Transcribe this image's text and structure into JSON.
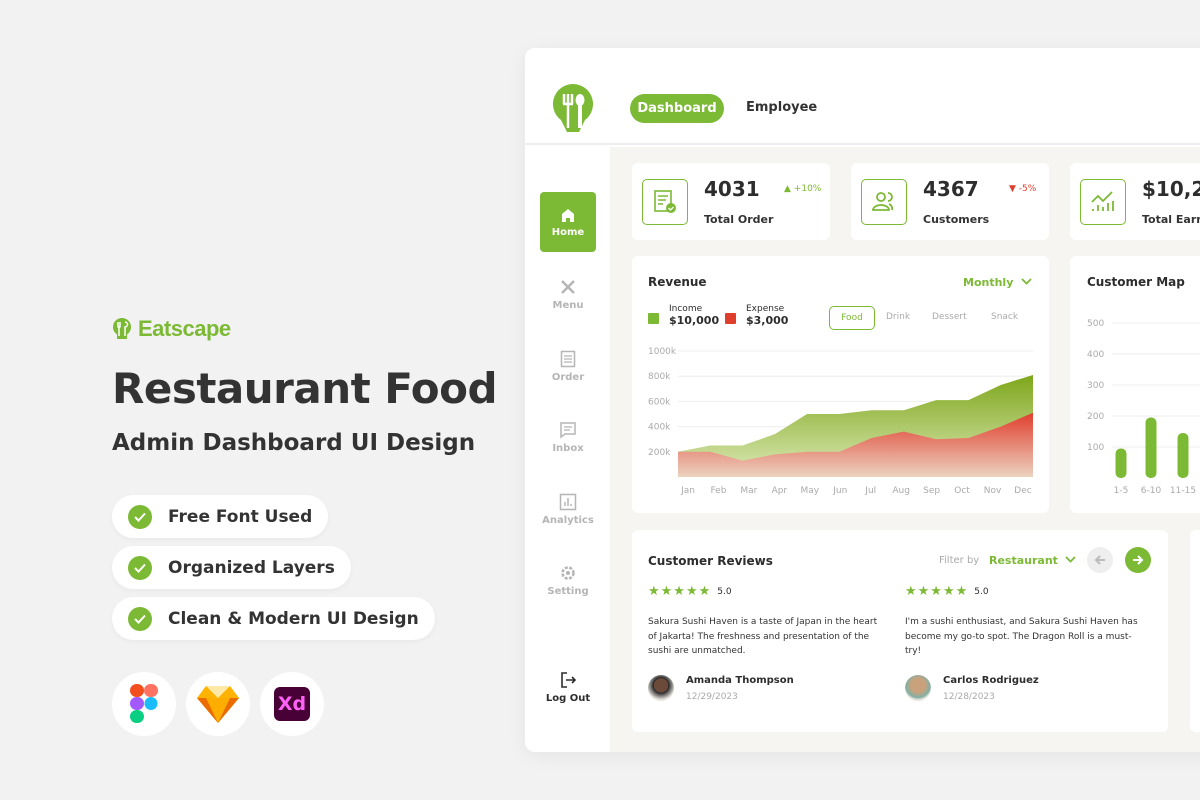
{
  "promo": {
    "brand": "Eatscape",
    "title": "Restaurant Food",
    "subtitle": "Admin Dashboard UI Design",
    "features": [
      "Free Font Used",
      "Organized Layers",
      "Clean & Modern UI Design"
    ],
    "tools": [
      {
        "name": "figma-icon"
      },
      {
        "name": "sketch-icon"
      },
      {
        "name": "xd-icon",
        "label": "Xd"
      }
    ]
  },
  "header": {
    "tabs": [
      {
        "label": "Dashboard",
        "active": true
      },
      {
        "label": "Employee",
        "active": false
      }
    ]
  },
  "sidebar": {
    "items": [
      {
        "label": "Home",
        "icon": "home-icon",
        "active": true
      },
      {
        "label": "Menu",
        "icon": "utensils-icon"
      },
      {
        "label": "Order",
        "icon": "receipt-icon"
      },
      {
        "label": "Inbox",
        "icon": "message-icon"
      },
      {
        "label": "Analytics",
        "icon": "chart-icon"
      },
      {
        "label": "Setting",
        "icon": "gear-icon"
      }
    ],
    "logout": "Log Out"
  },
  "stats": [
    {
      "value": "4031",
      "label": "Total Order",
      "change": "+10%",
      "trend": "up"
    },
    {
      "value": "4367",
      "label": "Customers",
      "change": "-5%",
      "trend": "down"
    },
    {
      "value": "$10,2",
      "label": "Total Earni"
    }
  ],
  "revenue": {
    "title": "Revenue",
    "period": "Monthly",
    "legend": [
      {
        "name": "Income",
        "value": "$10,000",
        "color": "#7cb935"
      },
      {
        "name": "Expense",
        "value": "$3,000",
        "color": "#e03e2d"
      }
    ],
    "filters": [
      "Food",
      "Drink",
      "Dessert",
      "Snack"
    ],
    "active_filter": "Food"
  },
  "customer_map": {
    "title": "Customer Map"
  },
  "reviews": {
    "title": "Customer Reviews",
    "filter_label": "Filter by",
    "filter_value": "Restaurant",
    "items": [
      {
        "rating": "5.0",
        "text": "Sakura Sushi Haven is a taste of Japan in the heart of Jakarta! The freshness and presentation of the sushi are unmatched.",
        "name": "Amanda Thompson",
        "date": "12/29/2023"
      },
      {
        "rating": "5.0",
        "text": "I'm a sushi enthusiast, and Sakura Sushi Haven has become my go-to spot. The Dragon Roll is a must-try!",
        "name": "Carlos Rodriguez",
        "date": "12/28/2023"
      }
    ]
  },
  "colors": {
    "accent": "#7cb935",
    "danger": "#e03e2d"
  },
  "chart_data": [
    {
      "type": "area",
      "categories": [
        "Jan",
        "Feb",
        "Mar",
        "Apr",
        "May",
        "Jun",
        "Jul",
        "Aug",
        "Sep",
        "Oct",
        "Nov",
        "Dec"
      ],
      "yticks": [
        "200k",
        "400k",
        "600k",
        "800k",
        "1000k"
      ],
      "ylim": [
        0,
        1000
      ],
      "grid": true,
      "series": [
        {
          "name": "Income",
          "values": [
            200,
            250,
            250,
            340,
            500,
            500,
            530,
            530,
            610,
            610,
            730,
            810
          ],
          "color": "#7cb935"
        },
        {
          "name": "Expense",
          "values": [
            200,
            200,
            130,
            180,
            200,
            200,
            310,
            360,
            300,
            310,
            400,
            510
          ],
          "color": "#e03e2d"
        }
      ]
    },
    {
      "type": "bar",
      "categories": [
        "1-5",
        "6-10",
        "11-15"
      ],
      "yticks": [
        "100",
        "200",
        "300",
        "400",
        "500"
      ],
      "ylim": [
        0,
        500
      ],
      "grid": true,
      "values": [
        95,
        195,
        145
      ],
      "color": "#7cb935"
    }
  ]
}
